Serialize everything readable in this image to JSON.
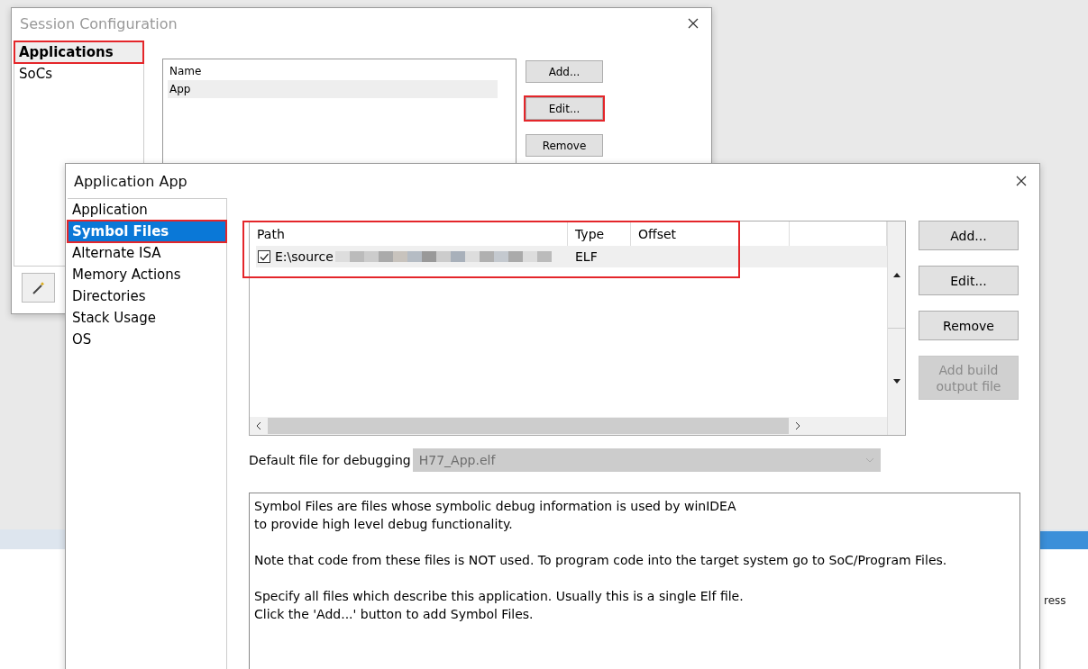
{
  "session_window": {
    "title": "Session Configuration",
    "categories": [
      {
        "label": "Applications",
        "selected": true,
        "highlighted": true
      },
      {
        "label": "SoCs",
        "selected": false,
        "highlighted": false
      }
    ],
    "list": {
      "columns": [
        "Name"
      ],
      "rows": [
        {
          "name": "App",
          "selected": true
        }
      ]
    },
    "buttons": [
      {
        "label": "Add...",
        "highlighted": false
      },
      {
        "label": "Edit...",
        "highlighted": true
      },
      {
        "label": "Remove",
        "highlighted": false
      }
    ]
  },
  "app_window": {
    "title": "Application App",
    "pages": [
      {
        "label": "Application",
        "selected": false,
        "highlighted": false
      },
      {
        "label": "Symbol Files",
        "selected": true,
        "highlighted": true
      },
      {
        "label": "Alternate ISA",
        "selected": false,
        "highlighted": false
      },
      {
        "label": "Memory Actions",
        "selected": false,
        "highlighted": false
      },
      {
        "label": "Directories",
        "selected": false,
        "highlighted": false
      },
      {
        "label": "Stack Usage",
        "selected": false,
        "highlighted": false
      },
      {
        "label": "OS",
        "selected": false,
        "highlighted": false
      }
    ],
    "table": {
      "highlighted": true,
      "columns": [
        "Path",
        "Type",
        "Offset"
      ],
      "rows": [
        {
          "checked": true,
          "path": "E:\\source",
          "path_blurred": true,
          "type": "ELF"
        }
      ]
    },
    "buttons": [
      {
        "label": "Add...",
        "disabled": false
      },
      {
        "label": "Edit...",
        "disabled": false
      },
      {
        "label": "Remove",
        "disabled": false
      },
      {
        "label": "Add build output file",
        "disabled": true
      }
    ],
    "default_file": {
      "label": "Default file for debugging",
      "value": "H77_App.elf",
      "disabled": true
    },
    "description": [
      [
        "Symbol Files are files whose symbolic debug information is used by winIDEA",
        "to provide high level debug functionality."
      ],
      [
        "Note that code from these files is NOT used. To program code into the target system go to SoC/Program Files."
      ],
      [
        "Specify all files which describe this application. Usually this is a single Elf file.",
        "Click the 'Add...' button to add Symbol Files."
      ]
    ]
  },
  "background_window": {
    "column_text": "ress"
  }
}
